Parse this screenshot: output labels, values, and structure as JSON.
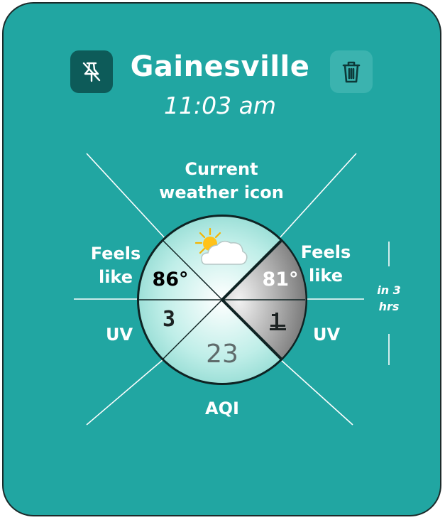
{
  "header": {
    "city": "Gainesville",
    "time": "11:03 am",
    "pin_icon": "unpin-icon",
    "trash_icon": "trash-icon"
  },
  "dial": {
    "feels_like_current": "86°",
    "feels_like_future": "81°",
    "uv_current": "3",
    "uv_future": "1",
    "aqi": "23",
    "weather_icon": "partly-cloudy-icon"
  },
  "annotations": {
    "top": "Current\nweather icon",
    "left_upper": "Feels\nlike",
    "right_upper": "Feels\nlike",
    "left_lower": "UV",
    "right_lower": "UV",
    "bottom": "AQI",
    "in_three": "in 3\nhrs"
  },
  "colors": {
    "card": "#21a6a2",
    "pin_button": "#0d5b59",
    "trash_button": "#3bb3af"
  }
}
